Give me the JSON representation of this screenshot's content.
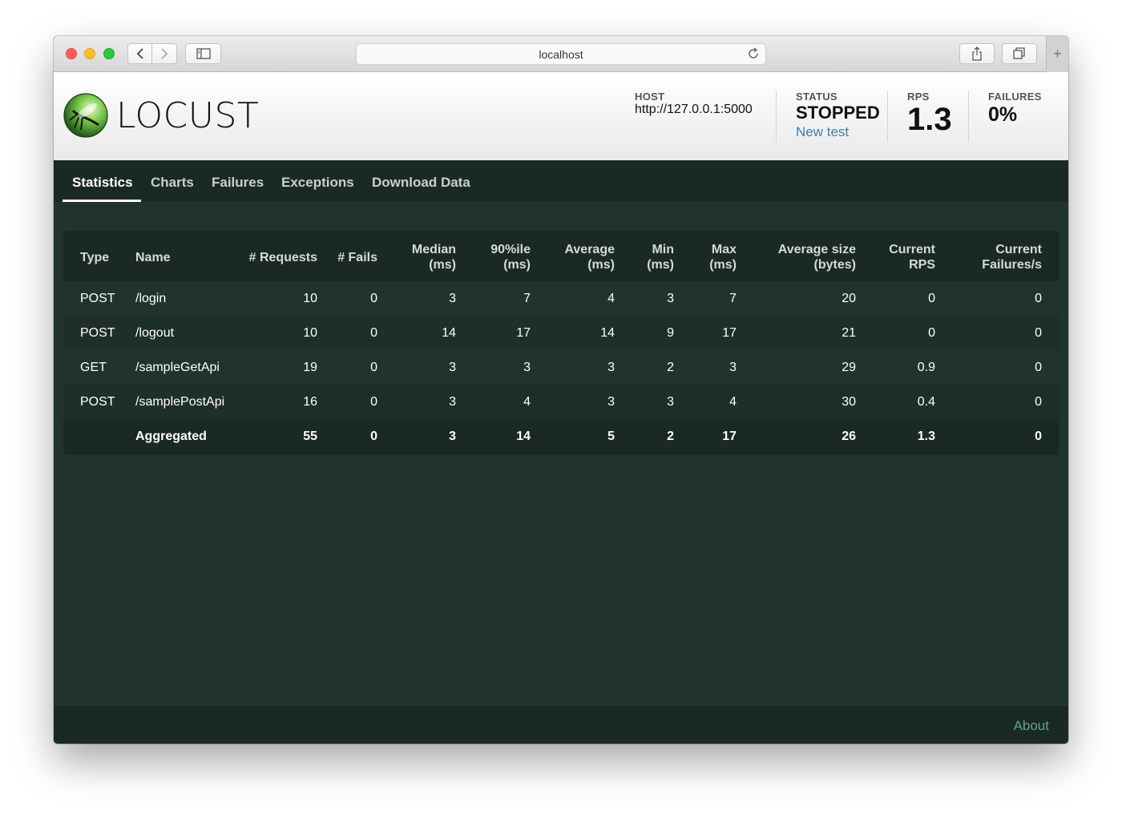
{
  "browser": {
    "url": "localhost"
  },
  "app": {
    "brand": "LOCUST",
    "host_label": "HOST",
    "host_value": "http://127.0.0.1:5000",
    "status_label": "STATUS",
    "status_value": "STOPPED",
    "new_test_label": "New test",
    "rps_label": "RPS",
    "rps_value": "1.3",
    "failures_label": "FAILURES",
    "failures_value": "0%"
  },
  "nav": {
    "tabs": [
      {
        "label": "Statistics",
        "active": true
      },
      {
        "label": "Charts",
        "active": false
      },
      {
        "label": "Failures",
        "active": false
      },
      {
        "label": "Exceptions",
        "active": false
      },
      {
        "label": "Download Data",
        "active": false
      }
    ]
  },
  "table": {
    "headers": {
      "type": [
        "Type"
      ],
      "name": [
        "Name"
      ],
      "requests": [
        "# Requests"
      ],
      "fails": [
        "# Fails"
      ],
      "median": [
        "Median",
        "(ms)"
      ],
      "p90": [
        "90%ile",
        "(ms)"
      ],
      "average": [
        "Average",
        "(ms)"
      ],
      "min": [
        "Min",
        "(ms)"
      ],
      "max": [
        "Max",
        "(ms)"
      ],
      "avg_size": [
        "Average size",
        "(bytes)"
      ],
      "current_rps": [
        "Current",
        "RPS"
      ],
      "current_failures": [
        "Current",
        "Failures/s"
      ]
    },
    "rows": [
      {
        "type": "POST",
        "name": "/login",
        "requests": "10",
        "fails": "0",
        "median": "3",
        "p90": "7",
        "average": "4",
        "min": "3",
        "max": "7",
        "avg_size": "20",
        "current_rps": "0",
        "current_failures": "0"
      },
      {
        "type": "POST",
        "name": "/logout",
        "requests": "10",
        "fails": "0",
        "median": "14",
        "p90": "17",
        "average": "14",
        "min": "9",
        "max": "17",
        "avg_size": "21",
        "current_rps": "0",
        "current_failures": "0"
      },
      {
        "type": "GET",
        "name": "/sampleGetApi",
        "requests": "19",
        "fails": "0",
        "median": "3",
        "p90": "3",
        "average": "3",
        "min": "2",
        "max": "3",
        "avg_size": "29",
        "current_rps": "0.9",
        "current_failures": "0"
      },
      {
        "type": "POST",
        "name": "/samplePostApi",
        "requests": "16",
        "fails": "0",
        "median": "3",
        "p90": "4",
        "average": "3",
        "min": "3",
        "max": "4",
        "avg_size": "30",
        "current_rps": "0.4",
        "current_failures": "0"
      }
    ],
    "aggregate": {
      "type": "",
      "name": "Aggregated",
      "requests": "55",
      "fails": "0",
      "median": "3",
      "p90": "14",
      "average": "5",
      "min": "2",
      "max": "17",
      "avg_size": "26",
      "current_rps": "1.3",
      "current_failures": "0"
    }
  },
  "footer": {
    "about_label": "About"
  },
  "colors": {
    "background": "#21332d",
    "nav_background": "#1b2924",
    "link": "#3d7fa8",
    "about_link": "#5fa38a"
  }
}
